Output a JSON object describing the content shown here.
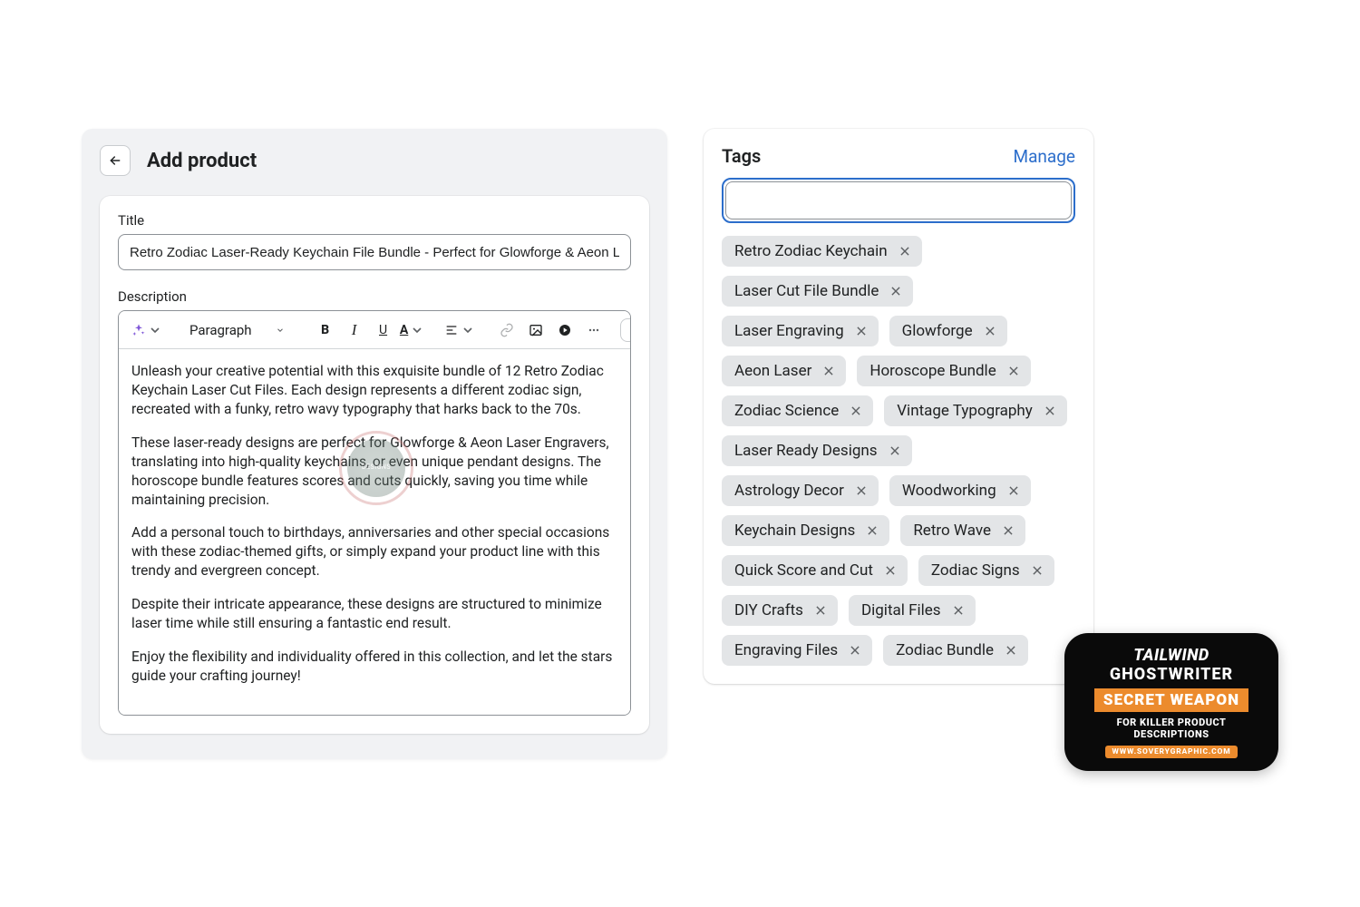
{
  "header": {
    "page_title": "Add product"
  },
  "title_field": {
    "label": "Title",
    "value": "Retro Zodiac Laser-Ready Keychain File Bundle - Perfect for Glowforge & Aeon Laser Engravers"
  },
  "description": {
    "label": "Description",
    "toolbar": {
      "format_label": "Paragraph"
    },
    "paragraphs": [
      "Unleash your creative potential with this exquisite bundle of 12 Retro Zodiac Keychain Laser Cut Files. Each design represents a different zodiac sign, recreated with a funky, retro wavy typography that harks back to the 70s.",
      "These laser-ready designs are perfect for Glowforge & Aeon Laser Engravers, translating into high-quality keychains, or even unique pendant designs. The horoscope bundle features scores and cuts quickly, saving you time while maintaining precision.",
      "Add a personal touch to birthdays, anniversaries and other special occasions with these zodiac-themed gifts, or simply expand your product line with this trendy and evergreen concept.",
      "Despite their intricate appearance, these designs are structured to minimize laser time while still ensuring a fantastic end result.",
      "Enjoy the flexibility and individuality offered in this collection, and let the stars guide your crafting journey!"
    ]
  },
  "tags_panel": {
    "title": "Tags",
    "manage_label": "Manage",
    "input_value": "",
    "tags": [
      "Retro Zodiac Keychain",
      "Laser Cut File Bundle",
      "Laser Engraving",
      "Glowforge",
      "Aeon Laser",
      "Horoscope Bundle",
      "Zodiac Science",
      "Vintage Typography",
      "Laser Ready Designs",
      "Astrology Decor",
      "Woodworking",
      "Keychain Designs",
      "Retro Wave",
      "Quick Score and Cut",
      "Zodiac Signs",
      "DIY Crafts",
      "Digital Files",
      "Engraving Files",
      "Zodiac Bundle"
    ]
  },
  "badge": {
    "line1": "TAILWIND",
    "line2": "GHOSTWRITER",
    "line3": "SECRET WEAPON",
    "line4": "FOR KILLER PRODUCT DESCRIPTIONS",
    "line5": "WWW.SOVERYGRAPHIC.COM"
  }
}
